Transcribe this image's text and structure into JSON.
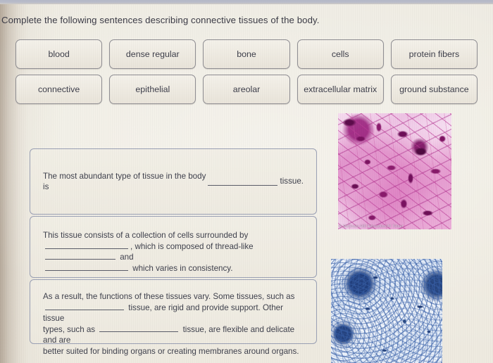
{
  "prompt": "Complete the following sentences describing connective tissues of the body.",
  "word_bank": {
    "row1": [
      {
        "label": "blood"
      },
      {
        "label": "dense regular"
      },
      {
        "label": "bone"
      },
      {
        "label": "cells"
      },
      {
        "label": "protein fibers"
      }
    ],
    "row2": [
      {
        "label": "connective"
      },
      {
        "label": "epithelial"
      },
      {
        "label": "areolar"
      },
      {
        "label": "extracellular matrix"
      },
      {
        "label": "ground substance"
      }
    ]
  },
  "sentences": [
    {
      "id": "sentence-1",
      "parts": {
        "p1": "The most abundant type of tissue in the body is",
        "p2": "tissue."
      }
    },
    {
      "id": "sentence-2",
      "parts": {
        "p1": "This tissue consists of a collection of cells surrounded by",
        "p2": ", which is composed of thread-like",
        "p3": "and",
        "p4": "which varies in consistency."
      }
    },
    {
      "id": "sentence-3",
      "parts": {
        "p1": "As a result, the functions of these tissues vary. Some tissues, such as",
        "p2": "tissue, are rigid and provide support. Other tissue",
        "p3": "types, such as",
        "p4": "tissue, are flexible and delicate and are",
        "p5": "better suited for binding organs or creating membranes around organs."
      }
    }
  ],
  "figures": [
    {
      "id": "figure-areolar",
      "alt": "areolar connective tissue micrograph",
      "credit": "© McGraw-Hill Education/Al Telser"
    },
    {
      "id": "figure-bone",
      "alt": "compact bone osteon micrograph",
      "credit": ""
    }
  ],
  "colors": {
    "page_background": "#efece3",
    "page_gutter": "#c6baac",
    "top_chrome": "#b3b7c6",
    "chip_border": "#8e8d92",
    "chip_fill": "#f1eee6",
    "box_border": "#9aa0b4",
    "text": "#3f414d",
    "blank_line": "#5a5c68",
    "micrograph_pink": "#d86eb9",
    "micrograph_blue": "#22407e"
  }
}
